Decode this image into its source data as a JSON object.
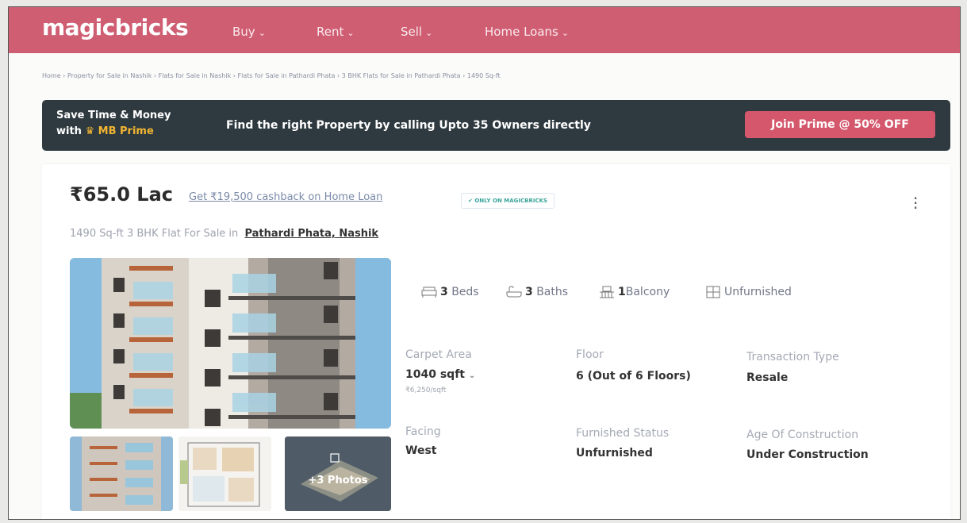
{
  "header": {
    "logo": "magicbricks",
    "nav": [
      "Buy",
      "Rent",
      "Sell",
      "Home Loans"
    ]
  },
  "breadcrumb": "Home › Property for Sale in Nashik › Flats for Sale in Nashik › Flats for Sale in Pathardi Phata › 3 BHK Flats for Sale in Pathardi Phata › 1490 Sq-ft",
  "prime": {
    "line1": "Save Time & Money",
    "with": "with",
    "brand": "MB Prime",
    "message": "Find the right Property by calling Upto 35 Owners directly",
    "cta": "Join Prime @ 50% OFF"
  },
  "listing": {
    "price": "₹65.0 Lac",
    "cashback": "Get ₹19,500 cashback on Home Loan",
    "exclusive": "ONLY ON MAGICBRICKS",
    "subtitle": "1490 Sq-ft 3 BHK Flat For Sale in",
    "location": "Pathardi Phata, Nashik",
    "photos_label": "+3 Photos",
    "amenities": {
      "beds_count": "3",
      "beds_label": "Beds",
      "baths_count": "3",
      "baths_label": "Baths",
      "balcony_count": "1",
      "balcony_label": "Balcony",
      "furnishing": "Unfurnished"
    },
    "details": {
      "carpet_label": "Carpet Area",
      "carpet_value": "1040 sqft",
      "carpet_rate": "₹6,250/sqft",
      "floor_label": "Floor",
      "floor_value": "6 (Out of 6 Floors)",
      "transaction_label": "Transaction Type",
      "transaction_value": "Resale",
      "facing_label": "Facing",
      "facing_value": "West",
      "furnished_label": "Furnished Status",
      "furnished_value": "Unfurnished",
      "age_label": "Age Of Construction",
      "age_value": "Under Construction"
    }
  },
  "colors": {
    "brand": "#cf5e73",
    "banner": "#2f3a40",
    "cta": "#d4576c",
    "gold": "#f2b531"
  }
}
